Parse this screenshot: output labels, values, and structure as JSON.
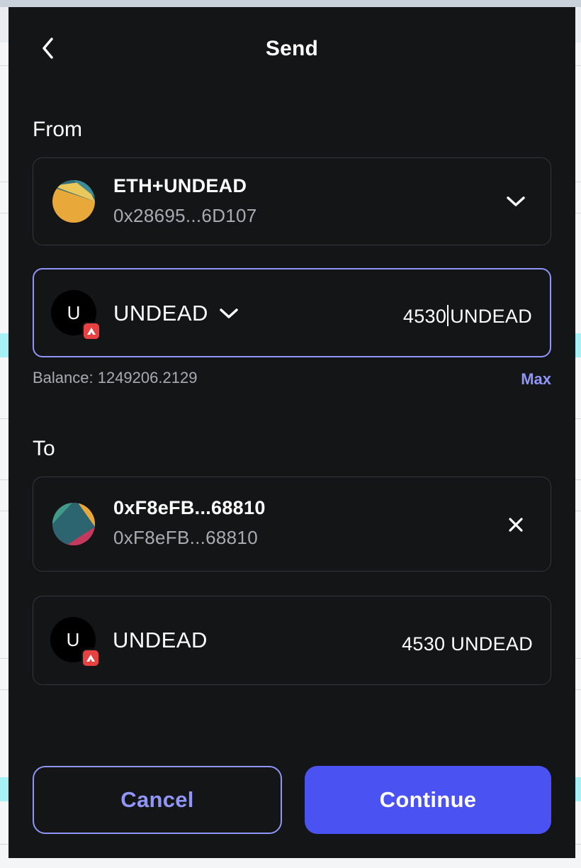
{
  "header": {
    "title": "Send"
  },
  "from": {
    "label": "From",
    "account_name": "ETH+UNDEAD",
    "account_address": "0x28695...6D107"
  },
  "amount_input": {
    "token_letter": "U",
    "token_symbol": "UNDEAD",
    "value": "4530",
    "unit": "UNDEAD"
  },
  "balance": {
    "text": "Balance: 1249206.2129",
    "max_label": "Max"
  },
  "to": {
    "label": "To",
    "recipient_name": "0xF8eFB...68810",
    "recipient_address": "0xF8eFB...68810"
  },
  "summary": {
    "token_letter": "U",
    "token_symbol": "UNDEAD",
    "amount": "4530",
    "unit": "UNDEAD"
  },
  "actions": {
    "cancel_label": "Cancel",
    "continue_label": "Continue"
  },
  "colors": {
    "background": "#141517",
    "accent": "#8f96f7",
    "primary_button": "#4a53f2",
    "chain_badge": "#e84142",
    "border": "#34363b"
  },
  "icons": {
    "back": "chevron-left-icon",
    "account_dropdown": "chevron-down-icon",
    "token_dropdown": "chevron-down-icon",
    "clear_recipient": "close-icon",
    "chain": "avalanche-icon"
  }
}
